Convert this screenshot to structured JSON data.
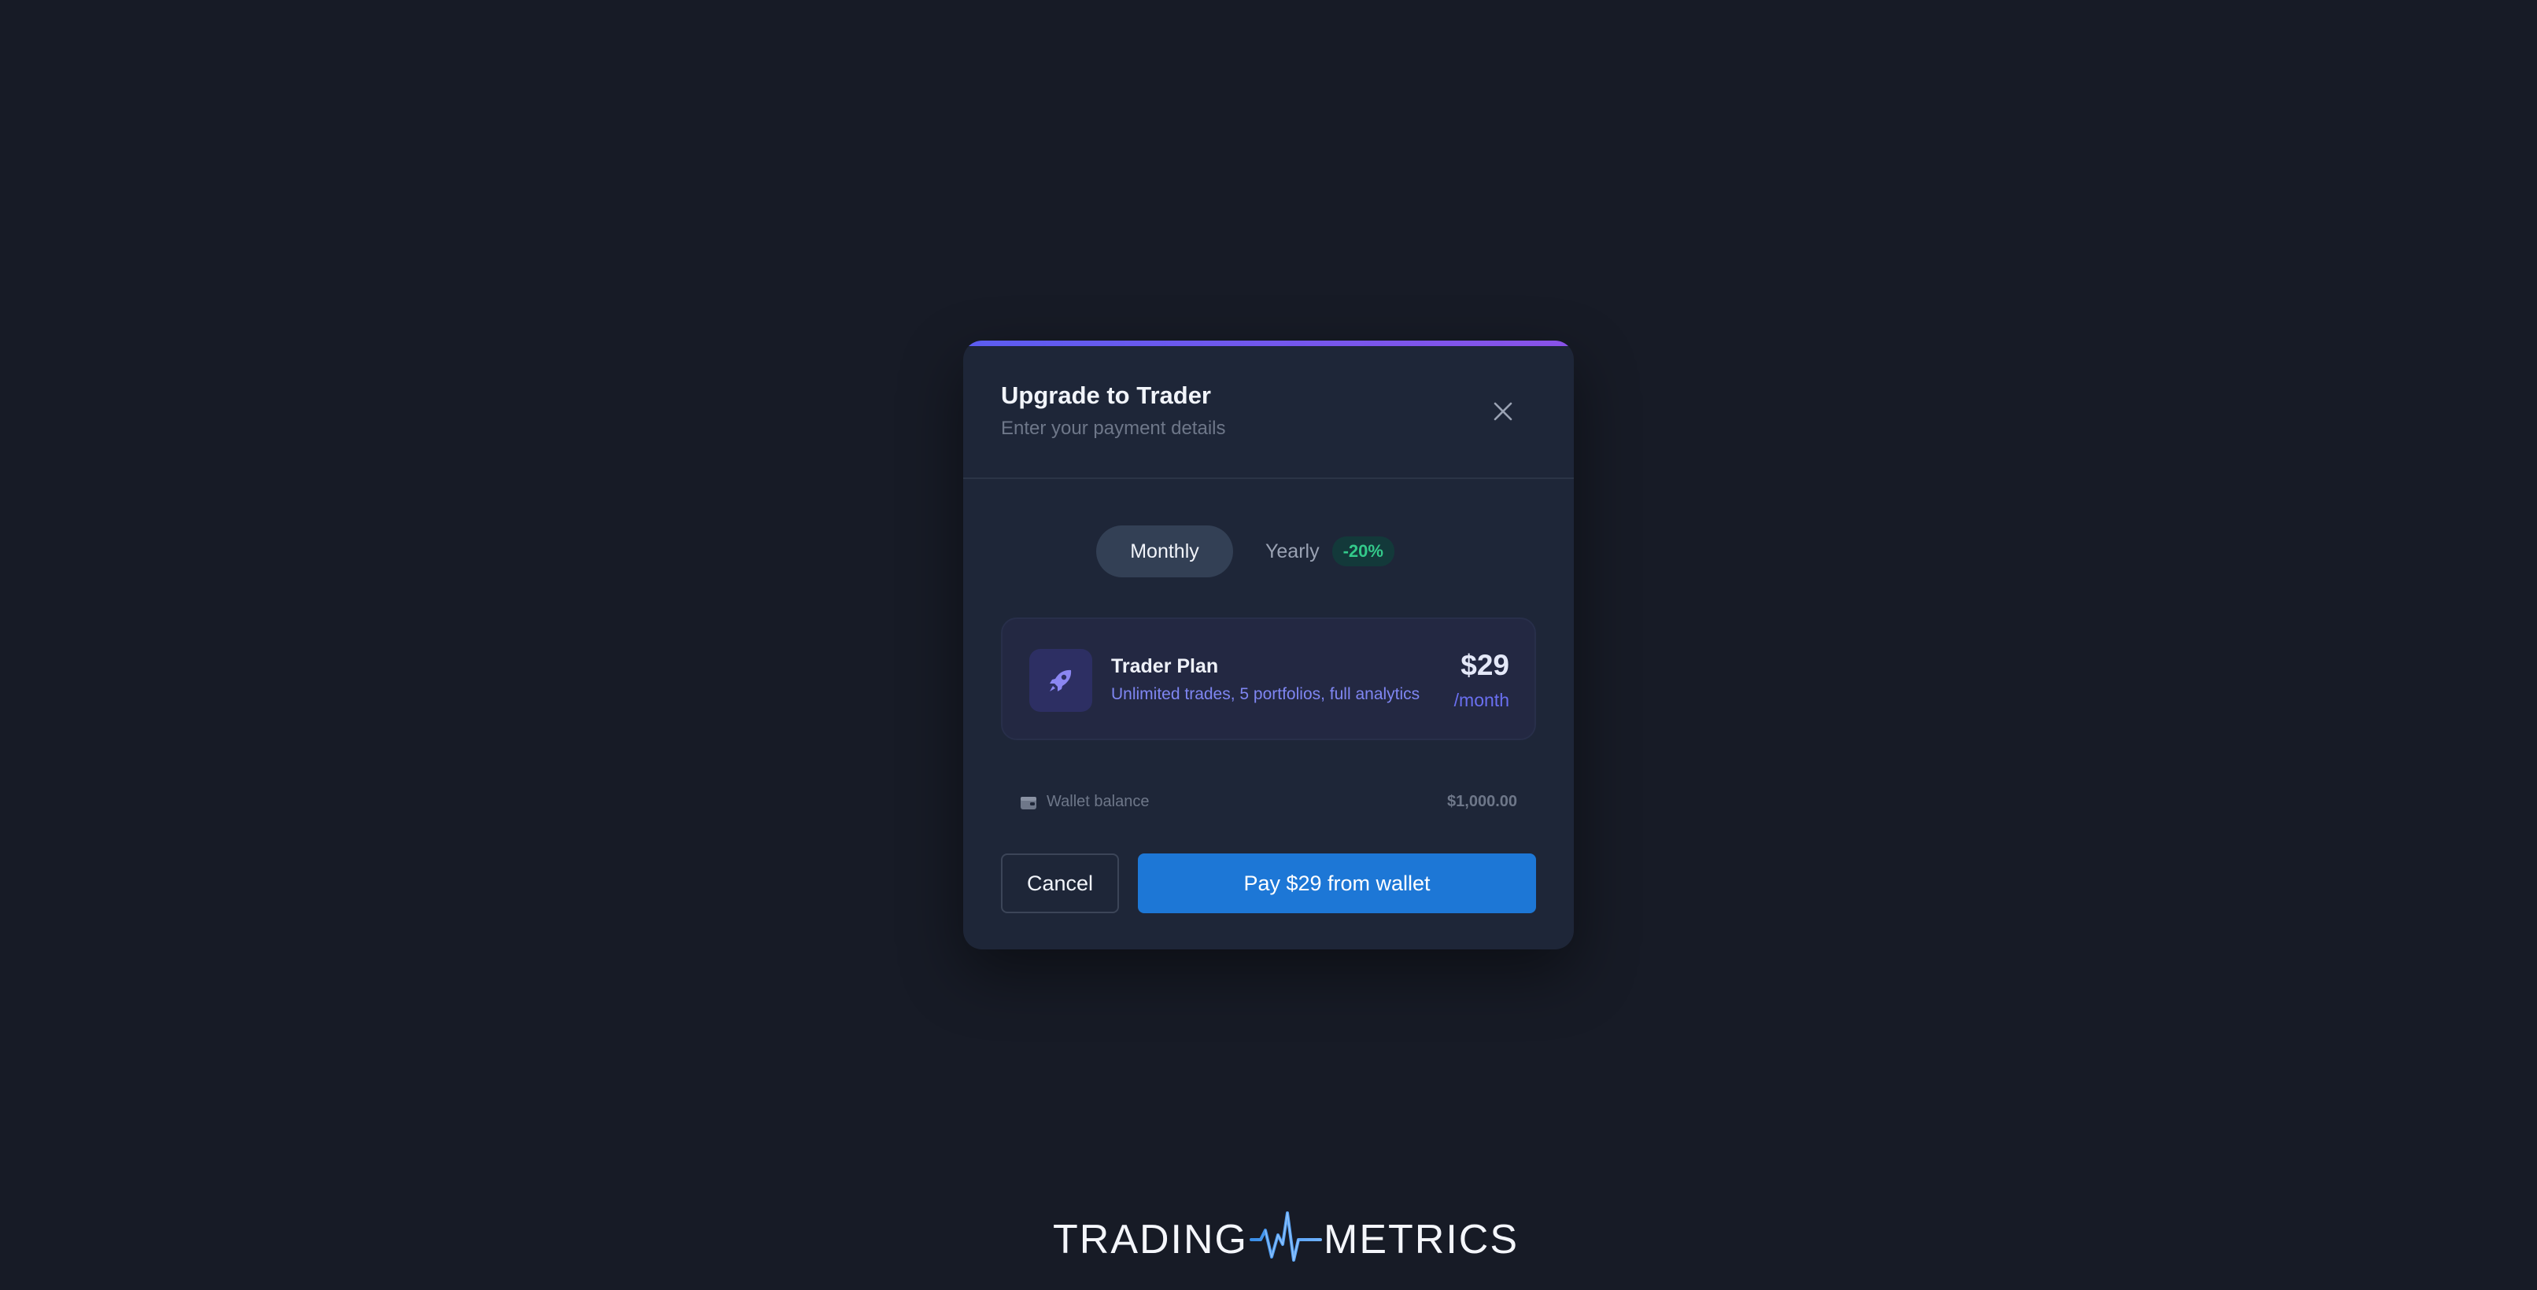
{
  "modal": {
    "title": "Upgrade to Trader",
    "subtitle": "Enter your payment details",
    "close_icon": "close-icon",
    "accent_gradient": [
      "#5b5cf0",
      "#8a52e8"
    ]
  },
  "billing": {
    "options": [
      {
        "label": "Monthly",
        "selected": true
      },
      {
        "label": "Yearly",
        "selected": false,
        "badge": "-20%"
      }
    ]
  },
  "plan": {
    "icon": "rocket-icon",
    "name": "Trader Plan",
    "description": "Unlimited trades, 5 portfolios, full analytics",
    "price": "$29",
    "period": "/month"
  },
  "wallet": {
    "icon": "wallet-icon",
    "label": "Wallet balance",
    "amount": "$1,000.00"
  },
  "actions": {
    "cancel_label": "Cancel",
    "pay_label": "Pay $29 from wallet",
    "pay_color": "#1d77d6"
  },
  "brand": {
    "left": "TRADING",
    "right": "METRICS",
    "mark_icon": "pulse-logo-icon"
  }
}
